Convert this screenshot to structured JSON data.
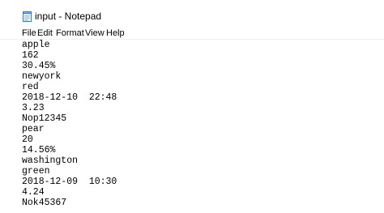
{
  "window": {
    "title": "input - Notepad"
  },
  "menu": {
    "items": [
      {
        "label": "File"
      },
      {
        "label": "Edit"
      },
      {
        "label": "Format"
      },
      {
        "label": "View"
      },
      {
        "label": "Help"
      }
    ]
  },
  "editor": {
    "lines": [
      "apple",
      "162",
      "30.45%",
      "newyork",
      "red",
      "2018-12-10  22:48",
      "3.23",
      "Nop12345",
      "pear",
      "20",
      "14.56%",
      "washington",
      "green",
      "2018-12-09  10:30",
      "4.24",
      "Nok45367"
    ]
  },
  "icons": {
    "app": "notepad-icon"
  }
}
